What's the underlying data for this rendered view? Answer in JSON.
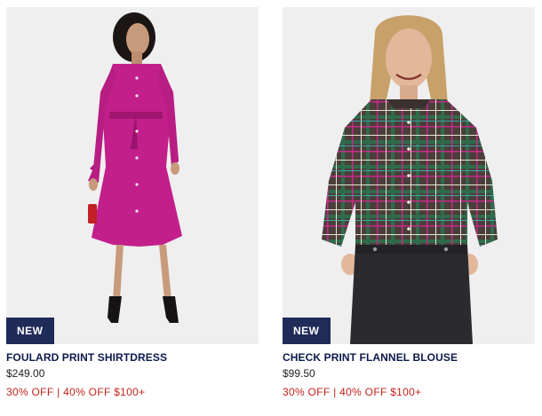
{
  "products": [
    {
      "badge": "NEW",
      "name": "FOULARD PRINT SHIRTDRESS",
      "price": "$249.00",
      "promo": "30% OFF | 40% OFF $100+"
    },
    {
      "badge": "NEW",
      "name": "CHECK PRINT FLANNEL BLOUSE",
      "price": "$99.50",
      "promo": "30% OFF | 40% OFF $100+"
    }
  ],
  "colors": {
    "badge_bg": "#1f2b58",
    "name_text": "#0c1a4b",
    "promo_text": "#c4211a",
    "image_bg": "#efefef"
  }
}
